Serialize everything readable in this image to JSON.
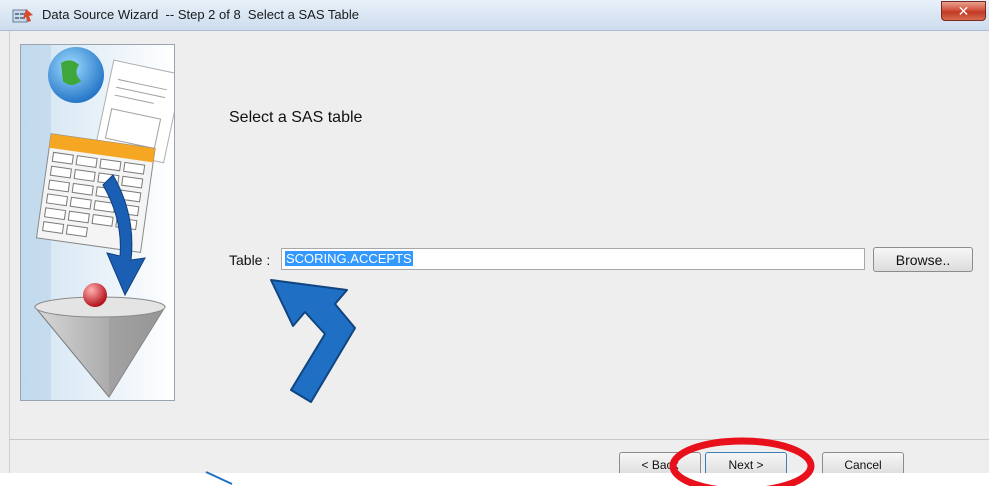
{
  "window": {
    "title": "Data Source Wizard  -- Step 2 of 8  Select a SAS Table",
    "close_label": "✕"
  },
  "main": {
    "heading": "Select a SAS table",
    "table_label": "Table :",
    "table_value": "SCORING.ACCEPTS",
    "browse_label": "Browse.."
  },
  "footer": {
    "back_label": "< Back",
    "next_label": "Next >",
    "cancel_label": "Cancel"
  },
  "colors": {
    "selection": "#3399ff",
    "annotation_arrow": "#1f6fc5",
    "annotation_circle": "#e8101a"
  },
  "icons": [
    "wizard-icon",
    "close-icon",
    "data-source-graphic"
  ]
}
